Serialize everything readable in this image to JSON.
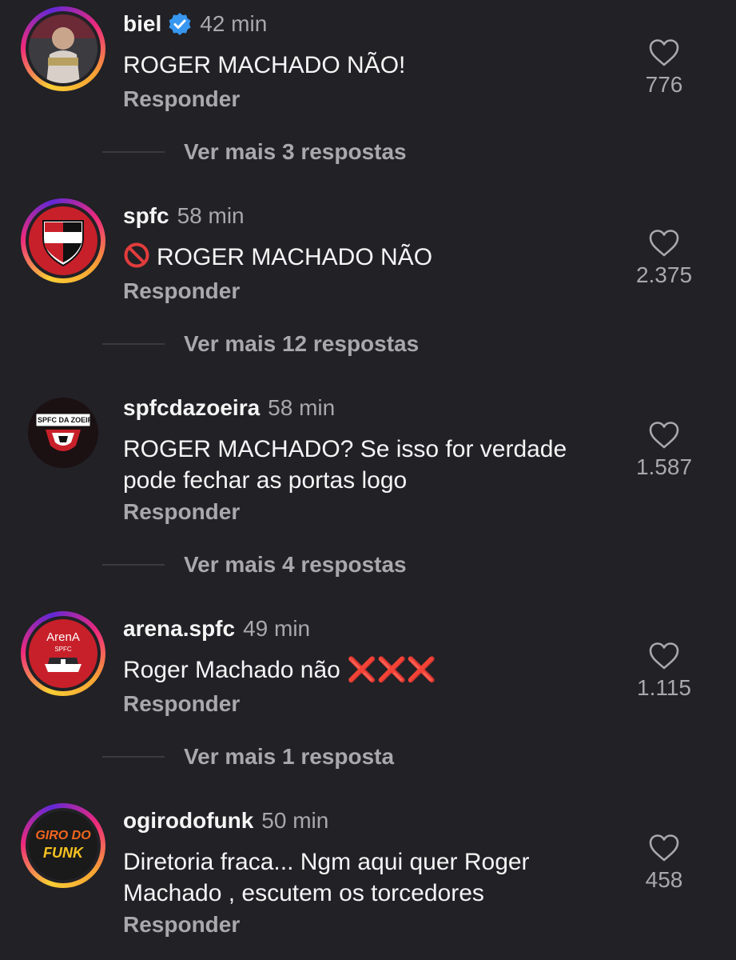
{
  "comments": [
    {
      "username": "biel",
      "time": "42 min",
      "text": "ROGER MACHADO NÃO!",
      "reply": "Responder",
      "likes": "776",
      "more": "Ver mais 3 respostas",
      "verified": true
    },
    {
      "username": "spfc",
      "time": "58 min",
      "text": "ROGER MACHADO NÃO",
      "reply": "Responder",
      "likes": "2.375",
      "more": "Ver mais 12 respostas",
      "emoji": "🚫"
    },
    {
      "username": "spfcdazoeira",
      "time": "58 min",
      "text_line1": "ROGER MACHADO? Se isso for verdade",
      "text_line2": "pode fechar as portas logo",
      "reply": "Responder",
      "likes": "1.587",
      "more": "Ver mais 4 respostas",
      "avatar_text": "SPFC DA ZOEIRA"
    },
    {
      "username": "arena.spfc",
      "time": "49 min",
      "text": "Roger Machado não",
      "emoji_suffix": "❌❌❌",
      "reply": "Responder",
      "likes": "1.115",
      "more": "Ver mais 1 resposta",
      "avatar_text_1": "ArenA",
      "avatar_text_2": "SPFC"
    },
    {
      "username": "ogirodofunk",
      "time": "50 min",
      "text_line1": "Diretoria fraca... Ngm aqui quer Roger",
      "text_line2": "Machado , escutem os torcedores",
      "reply": "Responder",
      "likes": "458",
      "avatar_text_1": "GIRO DO",
      "avatar_text_2": "FUNK"
    }
  ],
  "colors": {
    "background": "#212126",
    "text_primary": "#f5f5f5",
    "text_secondary": "#a8a8ad",
    "verified_blue": "#3897f0"
  }
}
